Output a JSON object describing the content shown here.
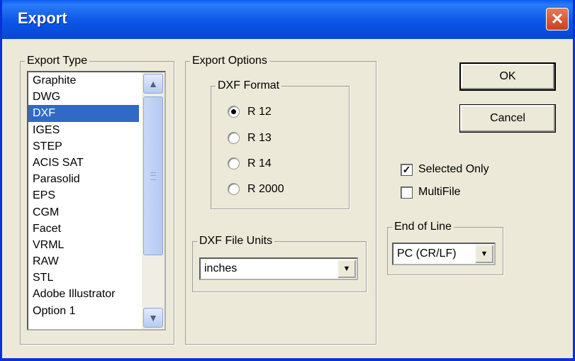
{
  "window": {
    "title": "Export",
    "close_glyph": "✕"
  },
  "export_type": {
    "label": "Export Type",
    "items": [
      "Graphite",
      "DWG",
      "DXF",
      "IGES",
      "STEP",
      "ACIS SAT",
      "Parasolid",
      "EPS",
      "CGM",
      "Facet",
      "VRML",
      "RAW",
      "STL",
      "Adobe Illustrator",
      "Option 1"
    ],
    "selected": "DXF"
  },
  "export_options": {
    "label": "Export Options",
    "dxf_format": {
      "label": "DXF Format",
      "options": [
        "R 12",
        "R 13",
        "R 14",
        "R 2000"
      ],
      "selected": "R 12"
    },
    "dxf_units": {
      "label": "DXF File Units",
      "value": "inches"
    }
  },
  "buttons": {
    "ok": "OK",
    "cancel": "Cancel"
  },
  "checkboxes": {
    "selected_only": {
      "label": "Selected Only",
      "checked": true
    },
    "multifile": {
      "label": "MultiFile",
      "checked": false
    }
  },
  "end_of_line": {
    "label": "End of Line",
    "value": "PC (CR/LF)"
  },
  "icons": {
    "scroll_up": "chevron-up-icon",
    "scroll_down": "chevron-down-icon",
    "dropdown": "triangle-down-icon"
  }
}
